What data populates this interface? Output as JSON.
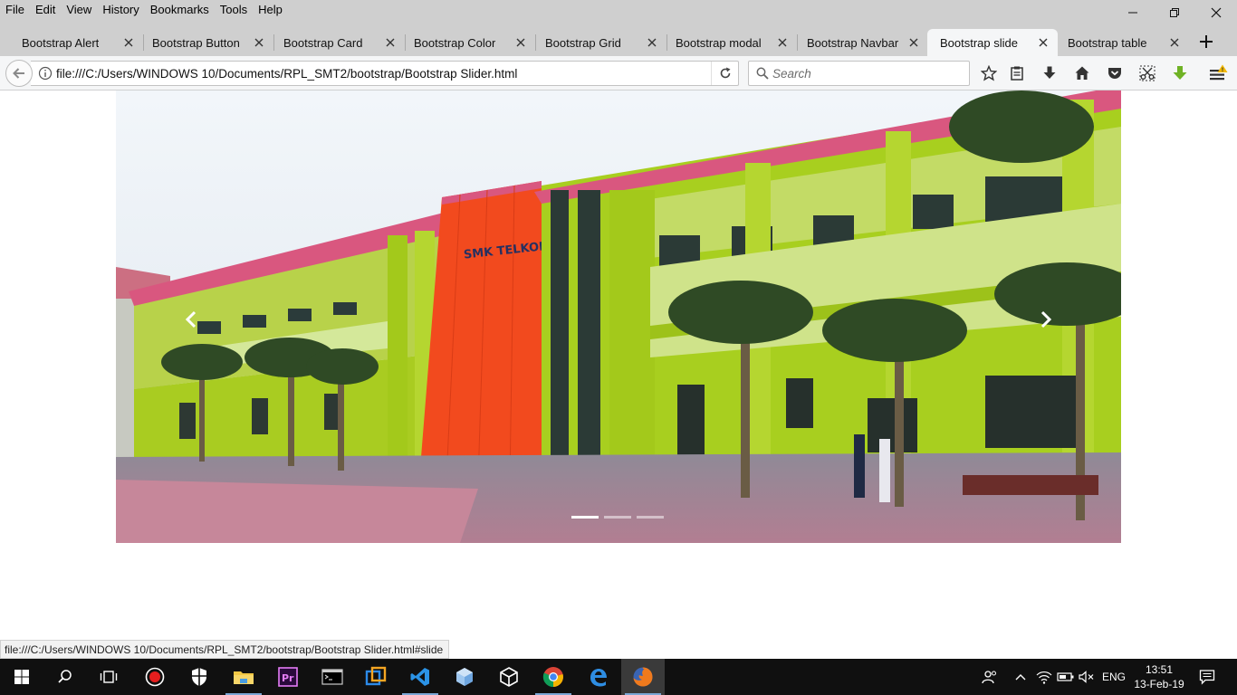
{
  "menu": [
    "File",
    "Edit",
    "View",
    "History",
    "Bookmarks",
    "Tools",
    "Help"
  ],
  "tabs": [
    {
      "label": "Bootstrap Alert",
      "active": false
    },
    {
      "label": "Bootstrap Button",
      "active": false
    },
    {
      "label": "Bootstrap Card",
      "active": false
    },
    {
      "label": "Bootstrap Color",
      "active": false
    },
    {
      "label": "Bootstrap Grid",
      "active": false
    },
    {
      "label": "Bootstrap modal",
      "active": false
    },
    {
      "label": "Bootstrap Navbar",
      "active": false
    },
    {
      "label": "Bootstrap slide",
      "active": true
    },
    {
      "label": "Bootstrap table",
      "active": false
    }
  ],
  "navbar": {
    "url": "file:///C:/Users/WINDOWS 10/Documents/RPL_SMT2/bootstrap/Bootstrap Slider.html",
    "search_placeholder": "Search"
  },
  "carousel": {
    "sign_text": "SMK TELKOM",
    "slide_count": 3,
    "active_index": 0
  },
  "statusbar": {
    "text": "file:///C:/Users/WINDOWS 10/Documents/RPL_SMT2/bootstrap/Bootstrap Slider.html#slide"
  },
  "taskbar": {
    "language": "ENG",
    "time": "13:51",
    "date": "13-Feb-19"
  },
  "colors": {
    "chrome": "#cfcfcf",
    "active_tab": "#f5f6f7",
    "taskbar": "#101010",
    "building_green": "#a9cf1e",
    "building_red": "#f24a1e",
    "roof_pink": "#d9577f"
  }
}
